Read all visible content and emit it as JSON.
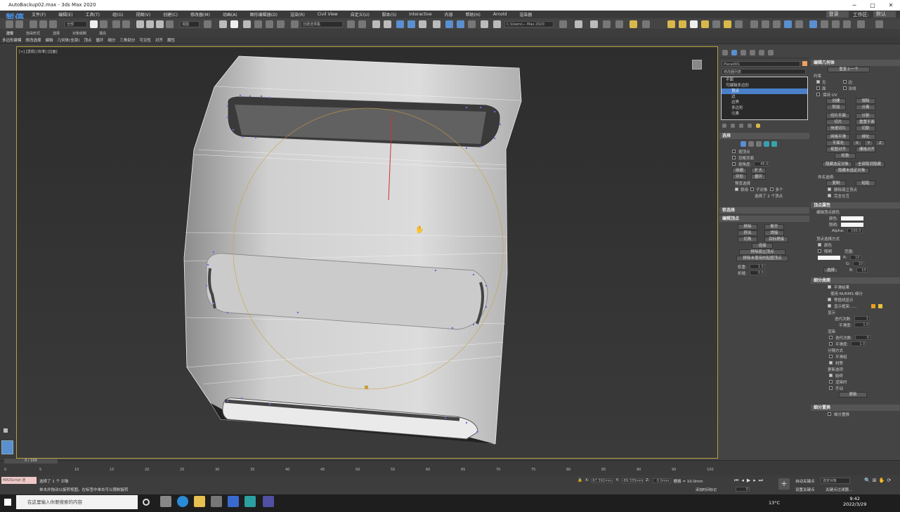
{
  "window": {
    "title": "AutoBackup02.max - 3ds Max 2020",
    "pause_overlay": "暂停"
  },
  "menu": {
    "items": [
      "文件(F)",
      "编辑(E)",
      "工具(T)",
      "组(G)",
      "视图(V)",
      "创建(C)",
      "修改器(M)",
      "动画(A)",
      "图形编辑器(D)",
      "渲染(R)",
      "Civil View",
      "自定义(U)",
      "脚本(S)",
      "Interactive",
      "内容",
      "帮助(H)",
      "Arnold",
      "渲染器"
    ],
    "user": "登录",
    "workspace_label": "工作区:",
    "workspace_value": "默认"
  },
  "toolbar": {
    "filter_dropdown": "全部",
    "coord_dropdown": "视图",
    "selset_dropdown": "创建选择集",
    "path_dropdown": "C:\\Users\\— Max 2020"
  },
  "ribbon": {
    "tabs": [
      "建模",
      "自由形式",
      "选择",
      "对象绘制",
      "填充"
    ],
    "tools": [
      "多边形建模",
      "修改选择",
      "编辑",
      "几何体(全部)",
      "顶点",
      "循环",
      "细分",
      "三角剖分",
      "可见性",
      "对齐",
      "属性"
    ]
  },
  "viewport": {
    "label": "[+] [透视] [标准] [边面]"
  },
  "command_panel": {
    "object_name": "Plane001",
    "modifier_list_label": "修改器列表",
    "stack": {
      "items": [
        "平面",
        "可编辑多边形",
        "顶点",
        "边",
        "边界",
        "多边形",
        "元素"
      ],
      "selected_index": 2
    },
    "selection_rollout": {
      "title": "选择",
      "by_vertex": "按顶点",
      "ignore_backfacing": "忽略背面",
      "by_angle": "按角度:",
      "by_angle_value": "45.0",
      "shrink": "收缩",
      "grow": "扩大",
      "ring": "环形",
      "loop": "循环",
      "preview_label": "预览选择",
      "preview_options": [
        "禁用",
        "子对象",
        "多个"
      ],
      "selection_status": "选择了 2 个顶点"
    },
    "soft_selection_title": "软选择",
    "edit_vertices": {
      "title": "编辑顶点",
      "remove": "移除",
      "break": "断开",
      "extrude": "挤出",
      "weld": "焊接",
      "chamfer": "切角",
      "target_weld": "目标焊接",
      "connect": "连接",
      "remove_isolated": "移除孤立顶点",
      "remove_unused_map": "移除未使用的贴图顶点",
      "weight_label": "权重:",
      "weight_value": "1.0",
      "crease_label": "折缝:",
      "crease_value": "0.0"
    }
  },
  "right_panel": {
    "edit_geometry": {
      "title": "编辑几何体",
      "repeat_last": "重复上一个",
      "constraints": "约束",
      "constraint_options": [
        "无",
        "边",
        "面",
        "法线"
      ],
      "preserve_uvs": "保持 UV",
      "create": "创建",
      "collapse": "塌陷",
      "attach": "附加",
      "detach": "分离",
      "slice_plane": "切片平面",
      "split": "分割",
      "slice": "切片",
      "reset_plane": "重置平面",
      "quickslice": "快速切片",
      "cut": "切割",
      "meshsmooth": "网格平滑",
      "tessellate": "细化",
      "planarize": "平面化",
      "xyz": [
        "X",
        "Y",
        "Z"
      ],
      "view_align": "视图对齐",
      "grid_align": "栅格对齐",
      "relax": "松弛",
      "hide_selected": "隐藏选定对象",
      "unhide_all": "全部取消隐藏",
      "hide_unselected": "隐藏未选定对象",
      "named_selections": "命名选择:",
      "copy": "复制",
      "paste": "粘贴",
      "delete_isolated": "删除孤立顶点",
      "full_interactivity": "完全交互"
    },
    "vertex_properties": {
      "title": "顶点属性",
      "edit_vertex_colors": "编辑顶点颜色",
      "color": "颜色:",
      "illumination": "照明:",
      "alpha": "Alpha:",
      "alpha_value": "100.0",
      "select_by": "顶点选择方式",
      "color_opt": "颜色",
      "illum_opt": "照明",
      "range": "范围:",
      "r": "R:",
      "g": "G:",
      "b": "B:",
      "range_value": "10",
      "select_btn": "选择"
    },
    "subdivision": {
      "title": "细分曲面",
      "smooth_result": "平滑结果",
      "use_nurms": "使用 NURMS 细分",
      "isoline_display": "等值线显示",
      "show_cage": "显示框架......",
      "display": "显示",
      "iterations": "迭代次数:",
      "iterations_value": "1",
      "smoothness": "平滑度:",
      "smoothness_value": "1.0",
      "render": "渲染",
      "render_iterations": "迭代次数:",
      "render_iter_value": "0",
      "render_smoothness": "平滑度:",
      "render_smooth_value": "1.0",
      "separate_by": "分隔方式",
      "smoothing_groups": "平滑组",
      "materials": "材质",
      "update_options": "更新选项",
      "always": "始终",
      "when_rendering": "渲染时",
      "manually": "手动",
      "update_btn": "更新"
    },
    "subdiv_displacement": {
      "title": "细分置换",
      "option": "细分置换"
    }
  },
  "timeline": {
    "frame_display": "0 / 100",
    "ticks": [
      "0",
      "5",
      "10",
      "15",
      "20",
      "25",
      "30",
      "35",
      "40",
      "45",
      "50",
      "55",
      "60",
      "65",
      "70",
      "75",
      "80",
      "85",
      "90",
      "95",
      "100"
    ]
  },
  "status": {
    "maxscript_label": "MAXScript 迷",
    "selected": "选择了 1 个 对象",
    "hint": "单击并拖动以旋转视图。在标签中单击可以限制旋转",
    "x_label": "X:",
    "x_value": "67.392mm",
    "y_label": "Y:",
    "y_value": "-89.335mm",
    "z_label": "Z:",
    "z_value": "0.0mm",
    "grid": "栅格 = 10.0mm",
    "add_time_tag": "添加时间标记",
    "auto_key": "自动关键点",
    "selected_obj": "选定对象",
    "set_key": "设置关键点",
    "key_filters": "关键点过滤器...",
    "frame_value": "0"
  },
  "taskbar": {
    "search_placeholder": "在这里输入你要搜索的内容",
    "temperature": "13°C",
    "time": "9:42",
    "date": "2022/3/29"
  },
  "colors": {
    "accent": "#4a80c8",
    "viewport_border": "#b8a040",
    "taskbar": "#1e1e1e"
  }
}
